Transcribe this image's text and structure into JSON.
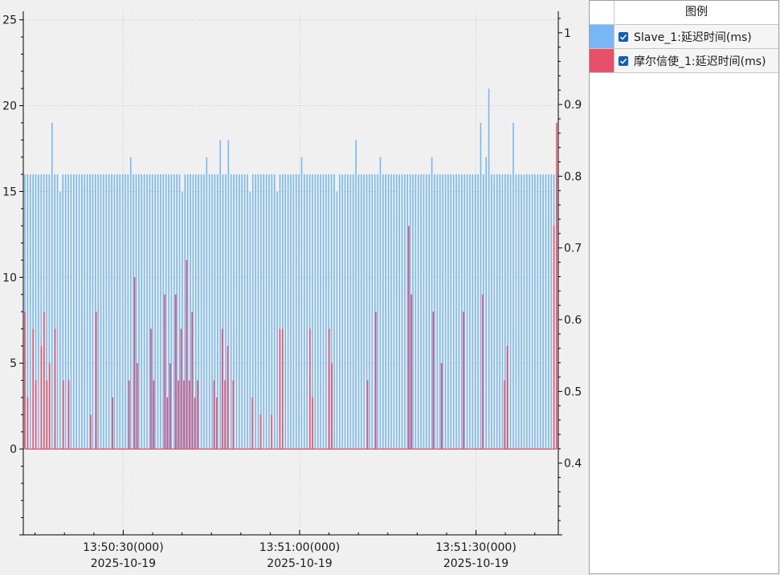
{
  "legend": {
    "title": "图例",
    "items": [
      {
        "label": "Slave_1:延迟时间(ms)",
        "color": "#77b7f5",
        "checked": true
      },
      {
        "label": "摩尔信使_1:延迟时间(ms)",
        "color": "#e8506a",
        "checked": true
      }
    ]
  },
  "chart_data": {
    "type": "bar",
    "title": "",
    "xlabel": "",
    "ylabel": "",
    "y_left": {
      "range": [
        -5,
        25.5
      ],
      "ticks": [
        0,
        5,
        10,
        15,
        20,
        25
      ]
    },
    "y_right": {
      "range": [
        0.3,
        1.03
      ],
      "ticks": [
        0.4,
        0.5,
        0.6,
        0.7,
        0.8,
        0.9,
        1
      ]
    },
    "x_range": [
      "13:50:13",
      "13:51:44"
    ],
    "x_ticks": [
      {
        "time": "13:50:30(000)",
        "date": "2025-10-19"
      },
      {
        "time": "13:51:00(000)",
        "date": "2025-10-19"
      },
      {
        "time": "13:51:30(000)",
        "date": "2025-10-19"
      }
    ],
    "grid": true,
    "series": [
      {
        "name": "Slave_1:延迟时间(ms)",
        "color": "#77b7f5",
        "values": [
          16,
          16,
          16,
          16,
          16,
          16,
          16,
          16,
          16,
          16,
          19,
          16,
          16,
          15,
          16,
          16,
          16,
          16,
          16,
          16,
          16,
          16,
          16,
          16,
          16,
          16,
          16,
          16,
          16,
          16,
          16,
          16,
          16,
          16,
          16,
          16,
          16,
          16,
          16,
          17,
          16,
          16,
          16,
          16,
          16,
          16,
          16,
          16,
          16,
          16,
          16,
          16,
          16,
          16,
          16,
          16,
          16,
          16,
          15,
          16,
          16,
          16,
          16,
          16,
          16,
          16,
          16,
          17,
          16,
          16,
          16,
          16,
          18,
          16,
          16,
          18,
          16,
          16,
          16,
          16,
          16,
          16,
          16,
          15,
          16,
          16,
          16,
          16,
          16,
          16,
          16,
          16,
          16,
          15,
          16,
          16,
          16,
          16,
          16,
          16,
          16,
          16,
          17,
          16,
          16,
          16,
          16,
          16,
          16,
          16,
          16,
          16,
          16,
          16,
          16,
          15,
          16,
          16,
          16,
          16,
          16,
          16,
          18,
          16,
          16,
          16,
          16,
          16,
          16,
          16,
          16,
          17,
          16,
          16,
          16,
          16,
          16,
          16,
          16,
          16,
          16,
          16,
          16,
          16,
          16,
          16,
          16,
          16,
          16,
          16,
          17,
          16,
          16,
          16,
          16,
          16,
          16,
          16,
          16,
          16,
          16,
          16,
          16,
          16,
          16,
          16,
          16,
          16,
          19,
          16,
          17,
          21,
          16,
          16,
          16,
          16,
          16,
          16,
          16,
          16,
          19,
          16,
          16,
          16,
          16,
          16,
          16,
          16,
          16,
          16,
          16,
          16,
          16,
          16,
          16,
          16,
          16
        ]
      },
      {
        "name": "摩尔信使_1:延迟时间(ms)",
        "color": "#e8506a",
        "values": [
          8,
          3,
          0,
          7,
          4,
          0,
          6,
          8,
          4,
          5,
          0,
          7,
          0,
          0,
          4,
          0,
          4,
          0,
          0,
          0,
          0,
          0,
          0,
          0,
          2,
          0,
          8,
          0,
          0,
          0,
          0,
          0,
          3,
          0,
          0,
          0,
          0,
          0,
          4,
          0,
          10,
          5,
          0,
          0,
          0,
          0,
          7,
          4,
          0,
          0,
          0,
          9,
          3,
          5,
          0,
          9,
          4,
          7,
          4,
          11,
          4,
          8,
          3,
          4,
          0,
          0,
          0,
          0,
          0,
          4,
          3,
          0,
          7,
          4,
          6,
          0,
          4,
          0,
          0,
          0,
          0,
          0,
          0,
          3,
          0,
          0,
          2,
          0,
          0,
          0,
          2,
          0,
          0,
          7,
          7,
          0,
          0,
          0,
          0,
          0,
          0,
          0,
          0,
          0,
          7,
          3,
          0,
          0,
          0,
          0,
          0,
          7,
          5,
          0,
          0,
          0,
          0,
          0,
          0,
          0,
          0,
          0,
          0,
          0,
          0,
          4,
          0,
          0,
          8,
          0,
          0,
          0,
          0,
          0,
          0,
          0,
          0,
          0,
          0,
          0,
          13,
          9,
          0,
          0,
          0,
          0,
          0,
          0,
          0,
          8,
          0,
          0,
          5,
          0,
          0,
          0,
          0,
          0,
          0,
          0,
          8,
          0,
          0,
          0,
          0,
          0,
          0,
          9,
          0,
          0,
          0,
          0,
          0,
          0,
          0,
          4,
          6,
          0,
          0,
          0,
          0,
          0,
          0,
          0,
          0,
          0,
          0,
          0,
          0,
          0,
          0,
          0,
          0,
          13,
          19
        ]
      }
    ]
  }
}
